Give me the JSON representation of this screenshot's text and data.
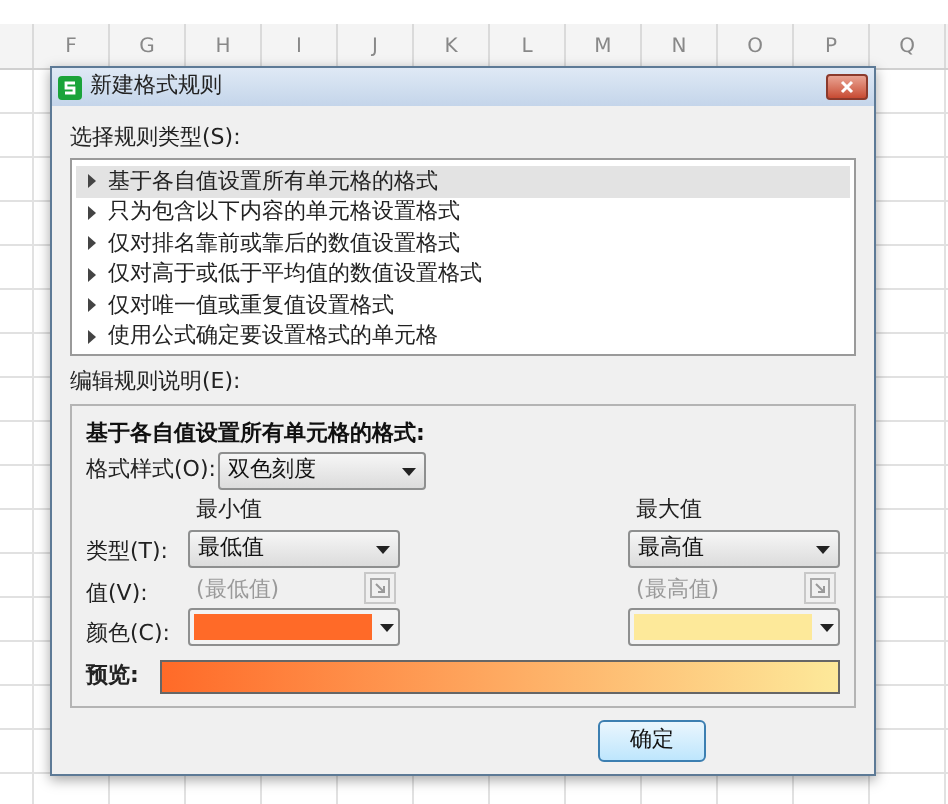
{
  "spreadsheet": {
    "columns": [
      "F",
      "G",
      "H",
      "I",
      "J",
      "K",
      "L",
      "M",
      "N",
      "O",
      "P",
      "Q"
    ]
  },
  "dialog": {
    "title": "新建格式规则",
    "rule_type_label": "选择规则类型(S):",
    "rule_types": [
      {
        "label": "基于各自值设置所有单元格的格式",
        "selected": true
      },
      {
        "label": "只为包含以下内容的单元格设置格式",
        "selected": false
      },
      {
        "label": "仅对排名靠前或靠后的数值设置格式",
        "selected": false
      },
      {
        "label": "仅对高于或低于平均值的数值设置格式",
        "selected": false
      },
      {
        "label": "仅对唯一值或重复值设置格式",
        "selected": false
      },
      {
        "label": "使用公式确定要设置格式的单元格",
        "selected": false
      }
    ],
    "edit_label": "编辑规则说明(E):",
    "description": {
      "heading": "基于各自值设置所有单元格的格式:",
      "format_style": {
        "label": "格式样式(O):",
        "value": "双色刻度"
      },
      "row_labels": {
        "type": "类型(T):",
        "value": "值(V):",
        "color_label": "颜色(C):"
      },
      "minimum": {
        "heading": "最小值",
        "type": "最低值",
        "value_placeholder": "(最低值)",
        "disabled": true,
        "color": "#ff6a28"
      },
      "maximum": {
        "heading": "最大值",
        "type": "最高值",
        "value_placeholder": "(最高值)",
        "disabled": true,
        "color": "#fde99a"
      },
      "preview_label": "预览:"
    },
    "buttons": [
      "确定"
    ]
  }
}
